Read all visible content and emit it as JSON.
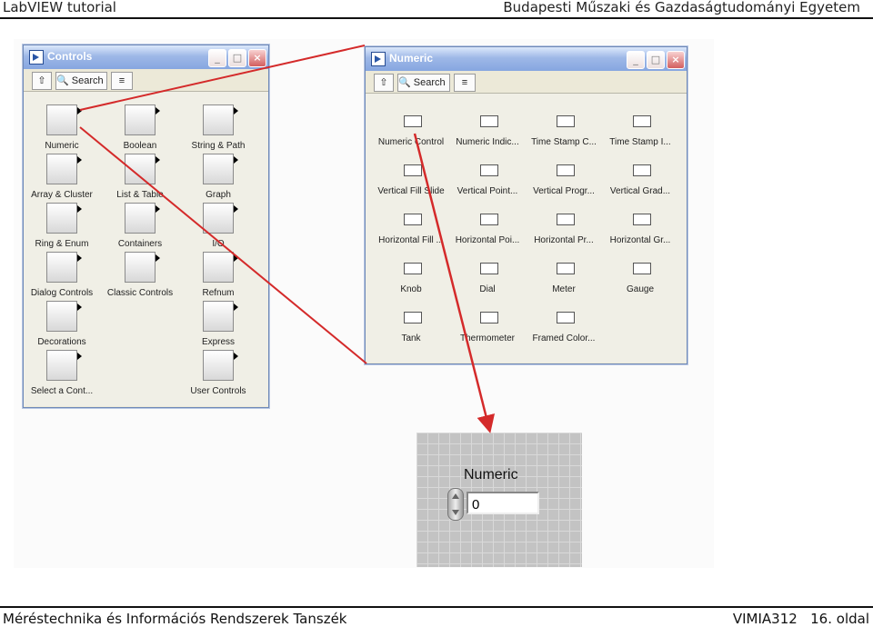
{
  "header": {
    "left": "LabVIEW tutorial",
    "right": "Budapesti Műszaki és Gazdaságtudományi Egyetem"
  },
  "footer": {
    "left": "Méréstechnika és Információs Rendszerek Tanszék",
    "course": "VIMIA312",
    "page": "16. oldal"
  },
  "controls_window": {
    "title": "Controls",
    "search_label": "Search",
    "items": [
      "Numeric",
      "Boolean",
      "String & Path",
      "Array & Cluster",
      "List & Table",
      "Graph",
      "Ring & Enum",
      "Containers",
      "I/O",
      "Dialog Controls",
      "Classic Controls",
      "Refnum",
      "Decorations",
      "Express",
      "Select a Cont...",
      "User Controls"
    ]
  },
  "numeric_window": {
    "title": "Numeric",
    "search_label": "Search",
    "items": [
      "Numeric Control",
      "Numeric Indic...",
      "Time Stamp C...",
      "Time Stamp I...",
      "Vertical Fill Slide",
      "Vertical Point...",
      "Vertical Progr...",
      "Vertical Grad...",
      "Horizontal Fill ...",
      "Horizontal Poi...",
      "Horizontal Pr...",
      "Horizontal Gr...",
      "Knob",
      "Dial",
      "Meter",
      "Gauge",
      "Tank",
      "Thermometer",
      "Framed Color..."
    ]
  },
  "front_panel": {
    "label": "Numeric",
    "value": "0"
  },
  "icons": {
    "up": "up-arrow-icon",
    "search": "magnifier-icon",
    "options": "view-options-icon"
  },
  "colors": {
    "arrow": "#d42a2a",
    "titlebar": "#86a6e0",
    "panel_grid": "#c3c3c3"
  }
}
